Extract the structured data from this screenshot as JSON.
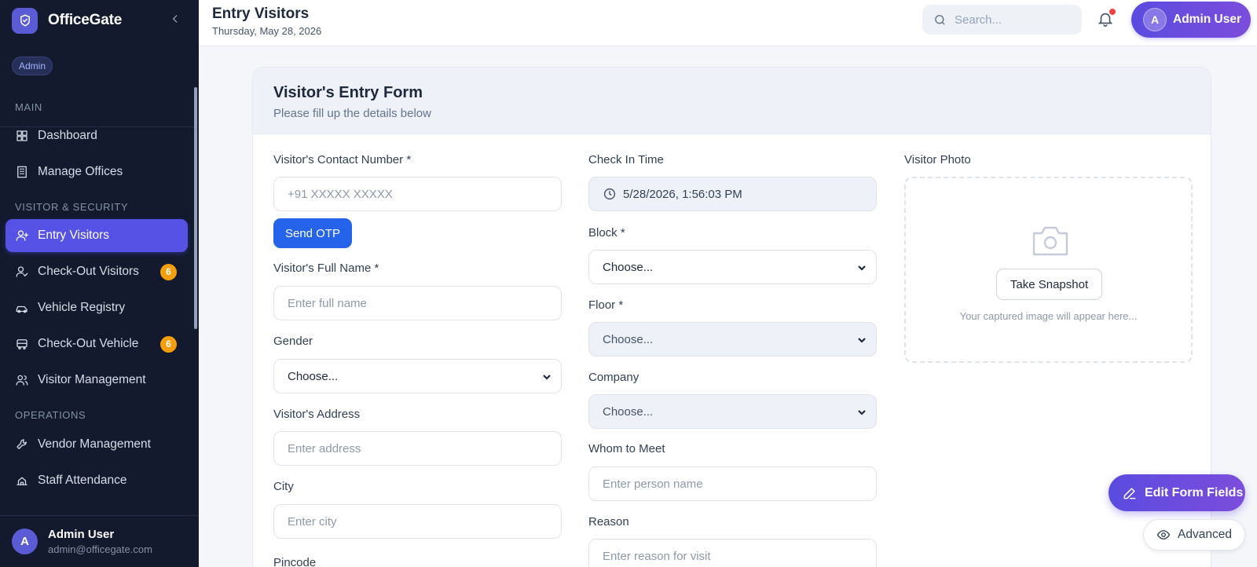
{
  "app": {
    "name": "OfficeGate",
    "role": "Admin"
  },
  "sidebar": {
    "sections": [
      {
        "label": "MAIN"
      },
      {
        "label": "VISITOR & SECURITY"
      },
      {
        "label": "OPERATIONS"
      }
    ],
    "items": [
      {
        "label": "Dashboard",
        "icon": "dashboard-icon"
      },
      {
        "label": "Manage Offices",
        "icon": "building-icon"
      },
      {
        "label": "Entry Visitors",
        "icon": "user-plus-icon",
        "active": true
      },
      {
        "label": "Check-Out Visitors",
        "icon": "user-check-icon",
        "badge": "6"
      },
      {
        "label": "Vehicle Registry",
        "icon": "car-icon"
      },
      {
        "label": "Check-Out Vehicle",
        "icon": "bus-icon",
        "badge": "6"
      },
      {
        "label": "Visitor Management",
        "icon": "users-icon"
      },
      {
        "label": "Vendor Management",
        "icon": "wrench-icon"
      },
      {
        "label": "Staff Attendance",
        "icon": "attendance-icon"
      }
    ],
    "user": {
      "initial": "A",
      "name": "Admin User",
      "email": "admin@officegate.com"
    }
  },
  "header": {
    "title": "Entry Visitors",
    "date": "Thursday, May 28, 2026",
    "search_placeholder": "Search...",
    "user_initial": "A",
    "user_name": "Admin User"
  },
  "form": {
    "title": "Visitor's Entry Form",
    "subtitle": "Please fill up the details below",
    "contact": {
      "label": "Visitor's Contact Number *",
      "placeholder": "+91 XXXXX XXXXX"
    },
    "send_otp": "Send OTP",
    "full_name": {
      "label": "Visitor's Full Name *",
      "placeholder": "Enter full name"
    },
    "gender": {
      "label": "Gender",
      "value": "Choose..."
    },
    "address": {
      "label": "Visitor's Address",
      "placeholder": "Enter address"
    },
    "city": {
      "label": "City",
      "placeholder": "Enter city"
    },
    "pincode": {
      "label": "Pincode"
    },
    "check_in": {
      "label": "Check In Time",
      "value": "5/28/2026, 1:56:03 PM"
    },
    "block": {
      "label": "Block *",
      "value": "Choose..."
    },
    "floor": {
      "label": "Floor *",
      "value": "Choose..."
    },
    "company": {
      "label": "Company",
      "value": "Choose..."
    },
    "whom": {
      "label": "Whom to Meet",
      "placeholder": "Enter person name"
    },
    "reason": {
      "label": "Reason",
      "placeholder": "Enter reason for visit"
    },
    "photo": {
      "label": "Visitor Photo",
      "snapshot": "Take Snapshot",
      "hint": "Your captured image will appear here..."
    }
  },
  "fab": {
    "edit": "Edit Form Fields",
    "advanced": "Advanced"
  },
  "colors": {
    "sidebar": "#131a2e",
    "accent": "#5552e5",
    "primary_button": "#2563eb",
    "badge": "#f59e0b"
  }
}
